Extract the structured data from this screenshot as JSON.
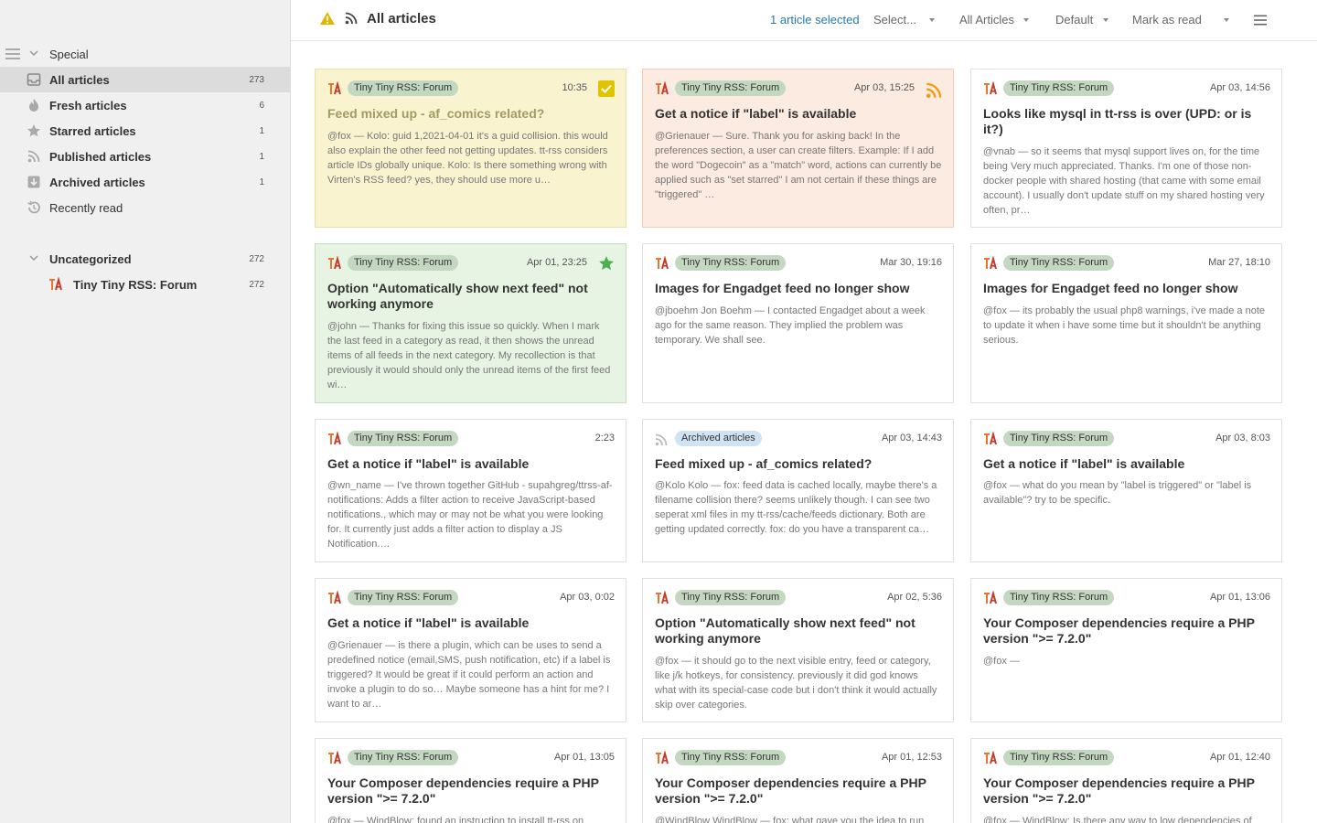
{
  "sidebar": {
    "special_label": "Special",
    "items": [
      {
        "label": "All articles",
        "count": "273"
      },
      {
        "label": "Fresh articles",
        "count": "6"
      },
      {
        "label": "Starred articles",
        "count": "1"
      },
      {
        "label": "Published articles",
        "count": "1"
      },
      {
        "label": "Archived articles",
        "count": "1"
      },
      {
        "label": "Recently read",
        "count": ""
      }
    ],
    "uncategorized": {
      "label": "Uncategorized",
      "count": "272"
    },
    "feed": {
      "label": "Tiny Tiny RSS: Forum",
      "count": "272"
    }
  },
  "toolbar": {
    "title": "All articles",
    "selected_count": "1 article selected",
    "select_label": "Select...",
    "view_label": "All Articles",
    "order_label": "Default",
    "mark_label": "Mark as read"
  },
  "colors": {
    "accent": "#257aa7",
    "warning": "#e1b600",
    "star": "#4caf50",
    "rss": "#f39c12",
    "selected_check": "#e1c400"
  },
  "articles": [
    {
      "feed": "Tiny Tiny RSS: Forum",
      "date": "10:35",
      "title": "Feed mixed up - af_comics related?",
      "excerpt": "@fox — Kolo: guid 1,2021-04-01 it's a guid collision. this would also explain the other feed not getting updates. tt-rss considers article IDs globally unique. Kolo: Is there something wrong with Virten's RSS feed? yes, they should use more u…"
    },
    {
      "feed": "Tiny Tiny RSS: Forum",
      "date": "Apr 03, 15:25",
      "title": "Get a notice if \"label\" is available",
      "excerpt": "@Grienauer — Sure. Thank you for asking back! In the preferences section, a user can create filters. Example: If I add the word \"Dogecoin\" as a \"match\" word, actions can currently be applied such as \"set starred\" I am not certain if these things are \"triggered\" …"
    },
    {
      "feed": "Tiny Tiny RSS: Forum",
      "date": "Apr 03, 14:56",
      "title": "Looks like mysql in tt-rss is over (UPD: or is it?)",
      "excerpt": "@vnab — so it seems that mysql support lives on, for the time being Very much appreciated. Thanks. I'm one of those non-docker people with shared hosting (that came with some email account). I usually don't update stuff on my shared hosting very often, pr…"
    },
    {
      "feed": "Tiny Tiny RSS: Forum",
      "date": "Apr 01, 23:25",
      "title": "Option \"Automatically show next feed\" not working anymore",
      "excerpt": "@john — Thanks for fixing this issue so quickly. When I mark the last feed in a category as read, it then shows the unread items of all feeds in the next category. My recollection is that previously it would should only the unread items of the first feed wi…"
    },
    {
      "feed": "Tiny Tiny RSS: Forum",
      "date": "Mar 30, 19:16",
      "title": "Images for Engadget feed no longer show",
      "excerpt": "@jboehm Jon Boehm — I contacted Engadget about a week ago for the same reason. They implied the problem was temporary. We shall see."
    },
    {
      "feed": "Tiny Tiny RSS: Forum",
      "date": "Mar 27, 18:10",
      "title": "Images for Engadget feed no longer show",
      "excerpt": "@fox — its probably the usual php8 warnings, i've made a note to update it when i have some time but it shouldn't be anything serious."
    },
    {
      "feed": "Tiny Tiny RSS: Forum",
      "date": "2:23",
      "title": "Get a notice if \"label\" is available",
      "excerpt": "@wn_name — I've thrown together GitHub - supahgreg/ttrss-af-notifications: Adds a filter action to receive JavaScript-based notifications., which may or may not be what you were looking for. It currently just adds a filter action to display a JS Notification.…"
    },
    {
      "feed": "Archived articles",
      "date": "Apr 03, 14:43",
      "title": "Feed mixed up - af_comics related?",
      "excerpt": "@Kolo Kolo — fox: feed data is cached locally, maybe there's a filename collision there? seems unlikely though. I can see two seperat xml files in my tt-rss/cache/feeds dictionary. Both are getting updated correctly. fox: do you have a transparent ca…"
    },
    {
      "feed": "Tiny Tiny RSS: Forum",
      "date": "Apr 03, 8:03",
      "title": "Get a notice if \"label\" is available",
      "excerpt": "@fox — what do you mean by \"label is triggered\" or \"label is available\"? try to be specific."
    },
    {
      "feed": "Tiny Tiny RSS: Forum",
      "date": "Apr 03, 0:02",
      "title": "Get a notice if \"label\" is available",
      "excerpt": "@Grienauer — is there a plugin, which can be uses to send a predefined notice (email,SMS, push notification, etc) if a label is triggered? It would be great if it could perform an action and invoke a plugin to do so… Maybe someone has a hint for me? I want to ar…"
    },
    {
      "feed": "Tiny Tiny RSS: Forum",
      "date": "Apr 02, 5:36",
      "title": "Option \"Automatically show next feed\" not working anymore",
      "excerpt": "@fox — it should go to the next visible entry, feed or category, like j/k hotkeys, for consistency. previously it did god knows what with its special-case code but i don't think it would actually skip over categories."
    },
    {
      "feed": "Tiny Tiny RSS: Forum",
      "date": "Apr 01, 13:06",
      "title": "Your Composer dependencies require a PHP version \">= 7.2.0\"",
      "excerpt": "@fox —"
    },
    {
      "feed": "Tiny Tiny RSS: Forum",
      "date": "Apr 01, 13:05",
      "title": "Your Composer dependencies require a PHP version \">= 7.2.0\"",
      "excerpt": "@fox — WindBlow: found an instruction to install tt-rss on"
    },
    {
      "feed": "Tiny Tiny RSS: Forum",
      "date": "Apr 01, 12:53",
      "title": "Your Composer dependencies require a PHP version \">= 7.2.0\"",
      "excerpt": "@WindBlow WindBlow — fox: what gave you the idea to run"
    },
    {
      "feed": "Tiny Tiny RSS: Forum",
      "date": "Apr 01, 12:40",
      "title": "Your Composer dependencies require a PHP version \">= 7.2.0\"",
      "excerpt": "@fox — WindBlow: Is there any way to low dependencies of"
    }
  ]
}
